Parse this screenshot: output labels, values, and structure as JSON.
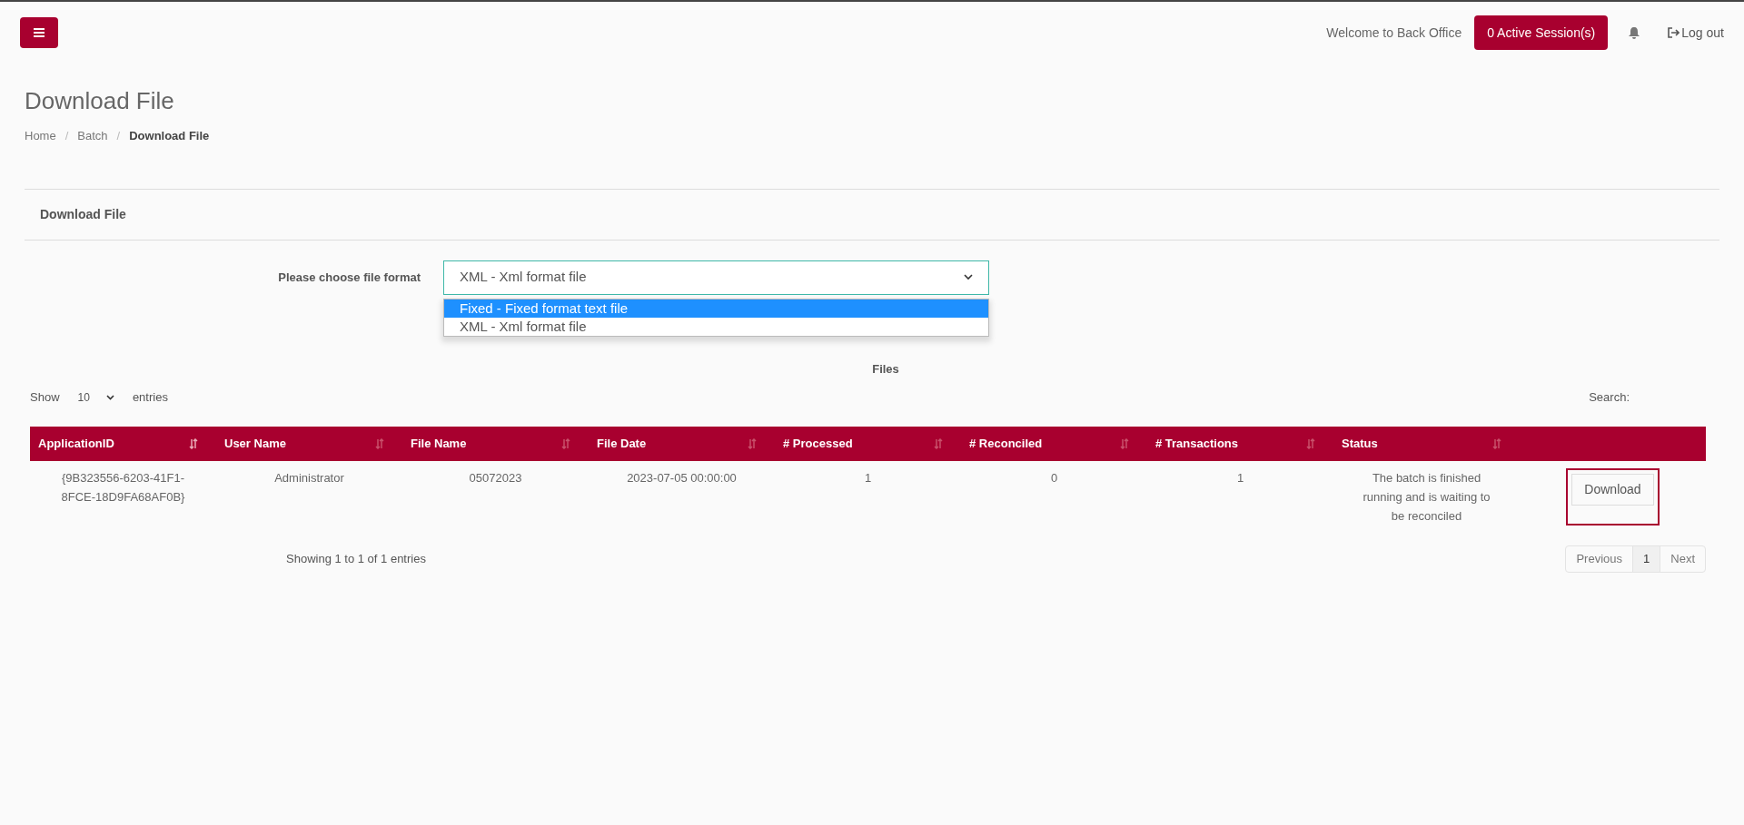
{
  "topbar": {
    "welcome": "Welcome to Back Office",
    "sessions_button": "0 Active Session(s)",
    "logout": "Log out"
  },
  "page": {
    "title": "Download File",
    "separator": "/",
    "breadcrumb": [
      {
        "label": "Home",
        "current": false
      },
      {
        "label": "Batch",
        "current": false
      },
      {
        "label": "Download File",
        "current": true
      }
    ]
  },
  "panel": {
    "title": "Download File",
    "format_label": "Please choose file format",
    "format_select": {
      "value": "XML - Xml format file",
      "expanded": true,
      "options": [
        {
          "label": "Fixed - Fixed format text file",
          "highlighted": true
        },
        {
          "label": "XML - Xml format file",
          "highlighted": false
        }
      ]
    },
    "files_title": "Files"
  },
  "table": {
    "show_label": "Show",
    "page_size": "10",
    "entries_label": "entries",
    "search_label": "Search:",
    "columns": [
      {
        "label": "ApplicationID",
        "sorted": true
      },
      {
        "label": "User Name",
        "sorted": false
      },
      {
        "label": "File Name",
        "sorted": false
      },
      {
        "label": "File Date",
        "sorted": false
      },
      {
        "label": "# Processed",
        "sorted": false
      },
      {
        "label": "# Reconciled",
        "sorted": false
      },
      {
        "label": "# Transactions",
        "sorted": false
      },
      {
        "label": "Status",
        "sorted": false
      }
    ],
    "rows": [
      {
        "cells": [
          "{9B323556-6203-41F1-8FCE-18D9FA68AF0B}",
          "Administrator",
          "05072023",
          "2023-07-05 00:00:00",
          "1",
          "0",
          "1",
          "The batch is finished running and is waiting to be reconciled"
        ],
        "action": "Download",
        "focused": true
      }
    ],
    "info": "Showing 1 to 1 of 1 entries",
    "pagination": [
      {
        "label": "Previous",
        "selected": false
      },
      {
        "label": "1",
        "selected": true
      },
      {
        "label": "Next",
        "selected": false
      }
    ]
  }
}
